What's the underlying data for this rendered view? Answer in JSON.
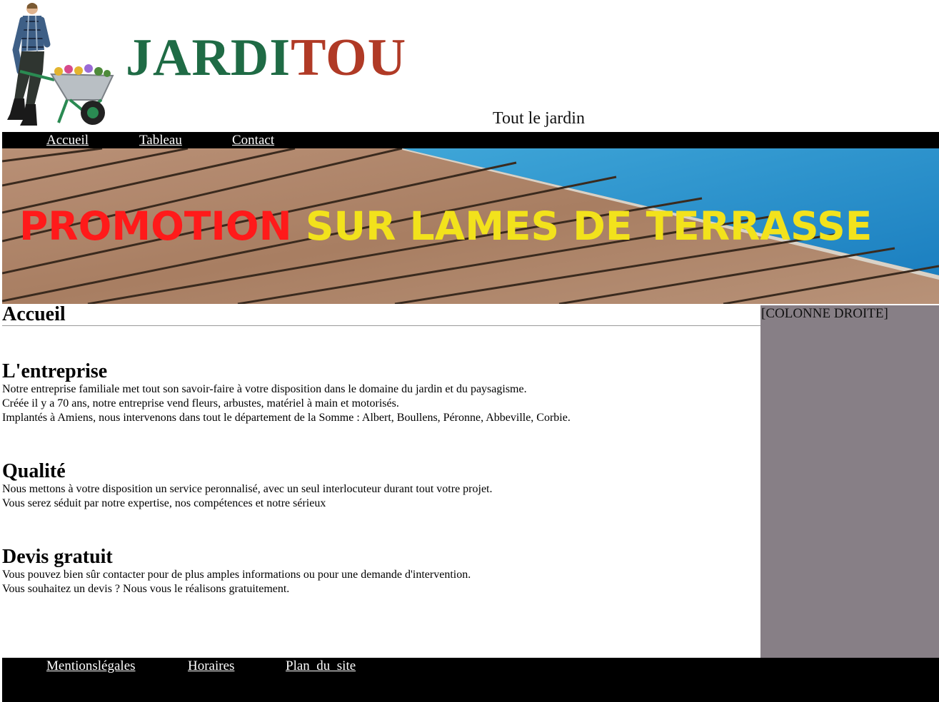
{
  "header": {
    "brand_part1": "JARDI",
    "brand_part2": "TOU",
    "tagline": "Tout le jardin",
    "brand_colors": {
      "green": "#1f6b45",
      "red": "#b03a26"
    },
    "logo_icon": "gardener-wheelbarrow-icon"
  },
  "nav": {
    "items": [
      {
        "label": "Accueil"
      },
      {
        "label": "Tableau"
      },
      {
        "label": "Contact"
      }
    ]
  },
  "banner": {
    "text_red": "PROMOTION",
    "text_yellow": "SUR LAMES DE TERRASSE",
    "colors": {
      "red": "#ff1a1a",
      "yellow": "#f2e21c"
    }
  },
  "main": {
    "page_title": "Accueil",
    "sections": [
      {
        "title": "L'entreprise",
        "lines": [
          "Notre entreprise familiale met tout son savoir-faire à votre disposition dans le domaine du jardin et du paysagisme.",
          "Créée il y a 70 ans, notre entreprise vend fleurs, arbustes, matériel à main et motorisés.",
          "Implantés à Amiens, nous intervenons dans tout le département de la Somme : Albert, Boullens, Péronne, Abbeville, Corbie."
        ]
      },
      {
        "title": "Qualité",
        "lines": [
          "Nous mettons à votre disposition un service peronnalisé, avec un seul interlocuteur durant tout votre projet.",
          "Vous serez séduit par notre expertise, nos compétences et notre sérieux"
        ]
      },
      {
        "title": "Devis gratuit",
        "lines": [
          "Vous pouvez bien sûr contacter pour de plus amples informations ou pour une demande d'intervention.",
          "Vous souhaitez un devis ? Nous vous le réalisons gratuitement."
        ]
      }
    ]
  },
  "right_column": {
    "label": "[COLONNE DROITE]",
    "color": "#877f86"
  },
  "footer": {
    "links": [
      {
        "label": "Mentionslégales"
      },
      {
        "label": "Horaires"
      },
      {
        "label": "Plan  du  site"
      }
    ]
  }
}
